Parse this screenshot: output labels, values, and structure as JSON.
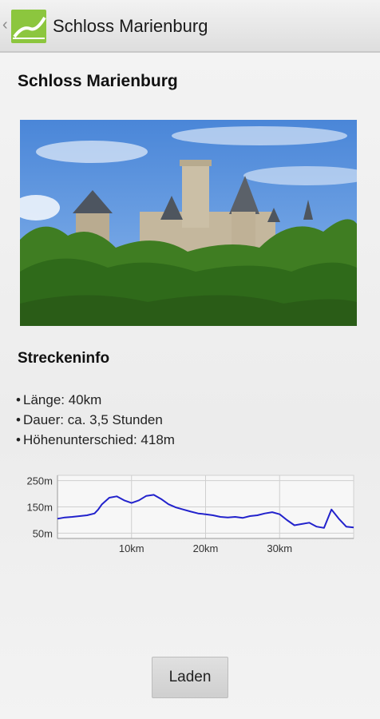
{
  "header": {
    "title": "Schloss Marienburg",
    "back_glyph": "‹",
    "logo_icon": "app-logo-icon"
  },
  "page": {
    "title": "Schloss Marienburg"
  },
  "section": {
    "title": "Streckeninfo"
  },
  "info": [
    {
      "bullet": "•",
      "text": "Länge: 40km"
    },
    {
      "bullet": "•",
      "text": "Dauer: ca. 3,5 Stunden"
    },
    {
      "bullet": "•",
      "text": "Höhenunterschied: 418m"
    }
  ],
  "chart_data": {
    "type": "line",
    "title": "",
    "xlabel": "",
    "ylabel": "",
    "x_unit": "km",
    "y_unit": "m",
    "xlim": [
      0,
      40
    ],
    "ylim": [
      30,
      270
    ],
    "y_ticks": [
      {
        "value": 250,
        "label": "250m"
      },
      {
        "value": 150,
        "label": "150m"
      },
      {
        "value": 50,
        "label": "50m"
      }
    ],
    "x_ticks": [
      {
        "value": 10,
        "label": "10km"
      },
      {
        "value": 20,
        "label": "20km"
      },
      {
        "value": 30,
        "label": "30km"
      }
    ],
    "grid": true,
    "series": [
      {
        "color": "#2222cc",
        "x": [
          0,
          1,
          2,
          3,
          4,
          5,
          5.5,
          6,
          7,
          8,
          9,
          10,
          11,
          12,
          13,
          14,
          15,
          16,
          17,
          18,
          19,
          20,
          21,
          22,
          23,
          24,
          25,
          26,
          27,
          28,
          29,
          30,
          31,
          32,
          33,
          34,
          35,
          36,
          37,
          38,
          39,
          40
        ],
        "y": [
          105,
          110,
          112,
          115,
          118,
          125,
          140,
          160,
          185,
          190,
          175,
          165,
          175,
          192,
          196,
          180,
          160,
          148,
          140,
          132,
          125,
          122,
          118,
          112,
          110,
          112,
          108,
          115,
          118,
          125,
          130,
          122,
          100,
          80,
          85,
          90,
          75,
          70,
          140,
          105,
          75,
          72
        ]
      }
    ]
  },
  "button": {
    "load_label": "Laden"
  },
  "colors": {
    "accent": "#8cc63e",
    "line": "#2222cc"
  }
}
